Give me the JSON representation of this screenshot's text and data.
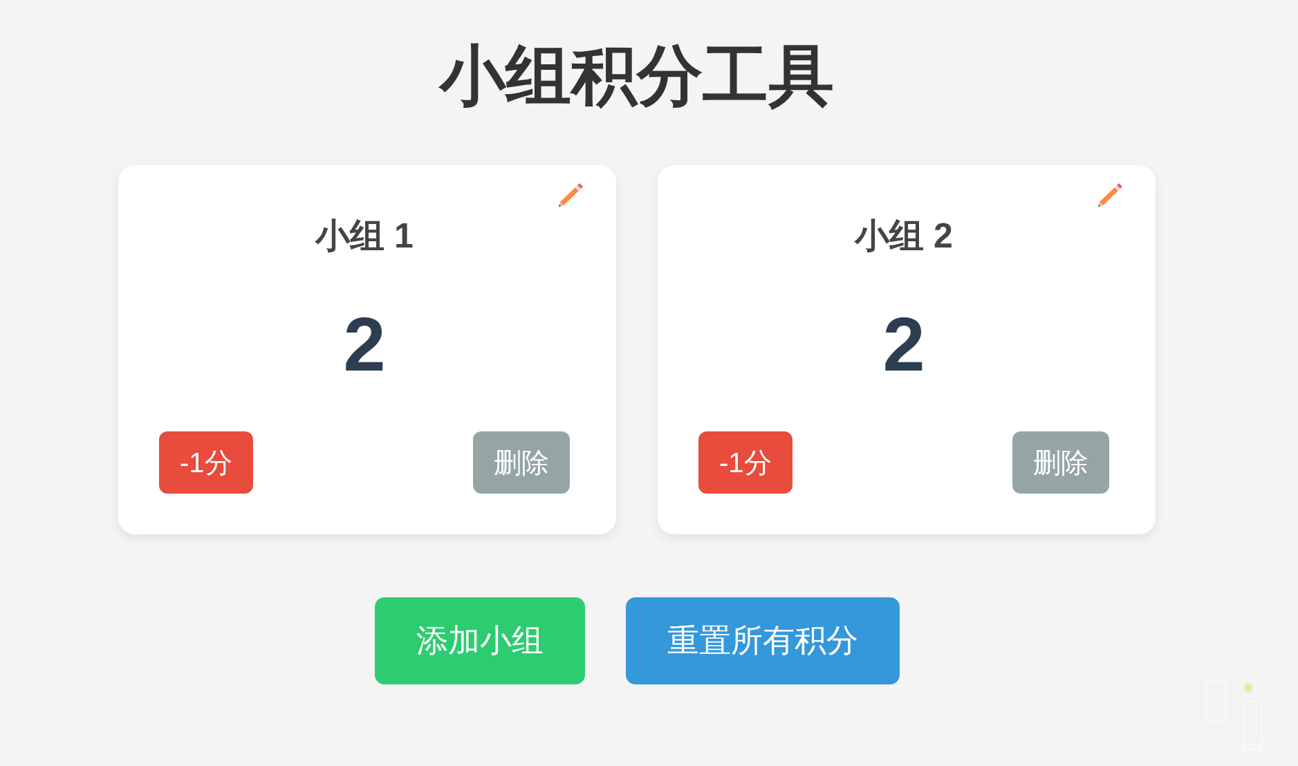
{
  "title": "小组积分工具",
  "groups": [
    {
      "name": "小组 1",
      "score": "2",
      "minus_button": "-1分",
      "delete_button": "删除"
    },
    {
      "name": "小组 2",
      "score": "2",
      "minus_button": "-1分",
      "delete_button": "删除"
    }
  ],
  "actions": [
    {
      "kind": "add",
      "label": "添加小组"
    },
    {
      "kind": "reset",
      "label": "重置所有积分"
    }
  ]
}
